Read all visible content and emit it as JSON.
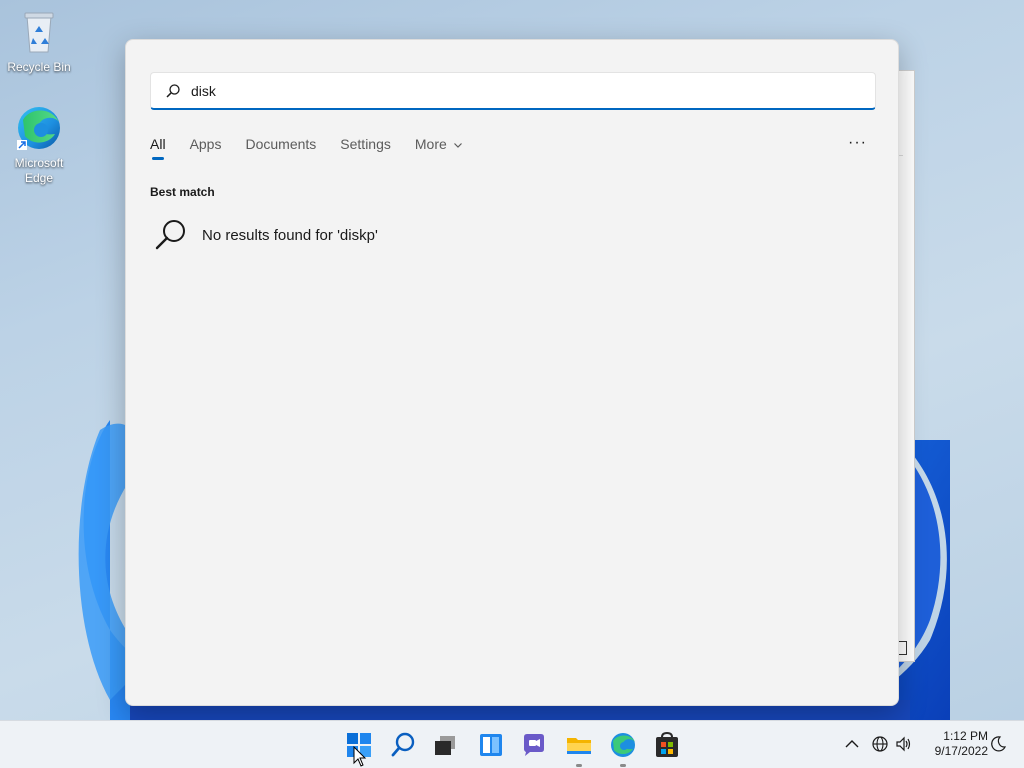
{
  "desktop": {
    "icons": [
      {
        "label": "Recycle Bin"
      },
      {
        "label": "Microsoft Edge"
      }
    ]
  },
  "search": {
    "query": "disk",
    "tabs": [
      "All",
      "Apps",
      "Documents",
      "Settings",
      "More"
    ],
    "more_options": "···",
    "best_match_label": "Best match",
    "no_results_text": "No results found for 'diskp'"
  },
  "taskbar": {
    "apps": [
      "start-icon",
      "search-icon",
      "task-view-icon",
      "widgets-icon",
      "chat-icon",
      "file-explorer-icon",
      "edge-icon",
      "store-icon"
    ],
    "time": "1:12 PM",
    "date": "9/17/2022"
  },
  "colors": {
    "accent": "#0067c0",
    "panel_bg": "#f3f3f3",
    "taskbar_bg": "#eef2f6"
  }
}
